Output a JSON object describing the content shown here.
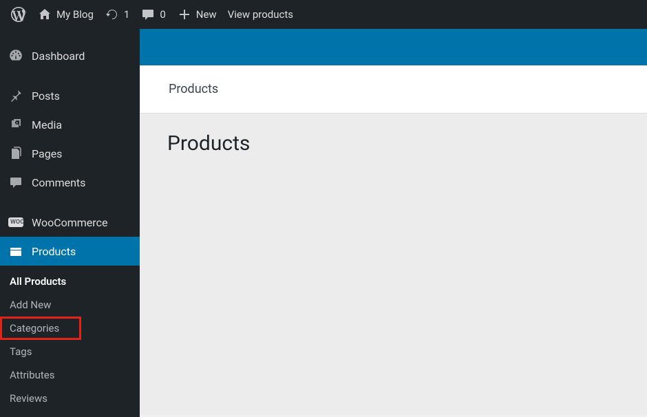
{
  "adminbar": {
    "site_name": "My Blog",
    "updates_count": "1",
    "comments_count": "0",
    "new_label": "New",
    "view_products_label": "View products"
  },
  "sidebar": {
    "dashboard": "Dashboard",
    "posts": "Posts",
    "media": "Media",
    "pages": "Pages",
    "comments": "Comments",
    "woocommerce": "WooCommerce",
    "products": "Products",
    "submenu": {
      "all_products": "All Products",
      "add_new": "Add New",
      "categories": "Categories",
      "tags": "Tags",
      "attributes": "Attributes",
      "reviews": "Reviews"
    }
  },
  "content": {
    "breadcrumb": "Products",
    "heading": "Products"
  }
}
